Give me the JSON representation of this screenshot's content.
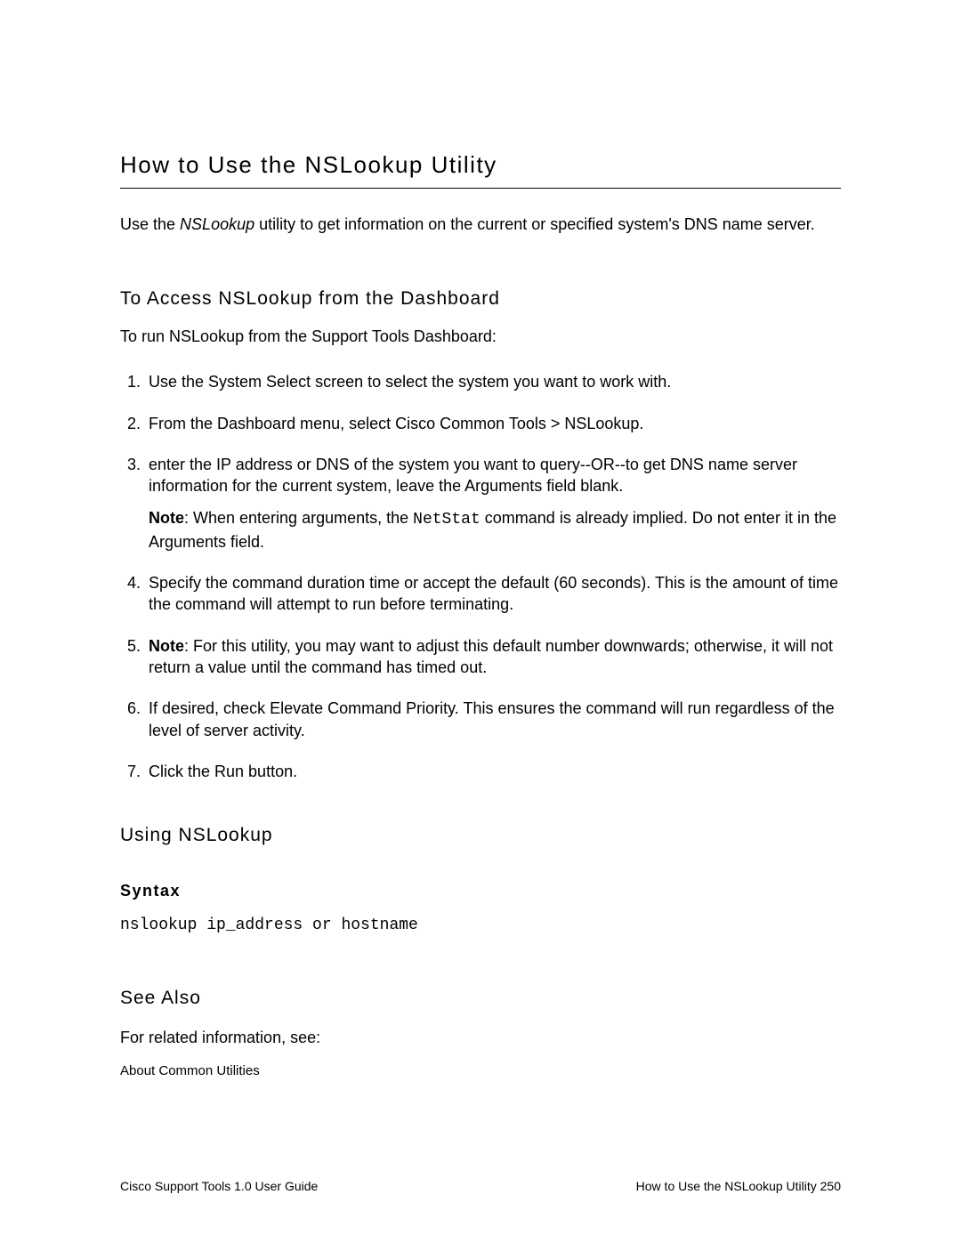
{
  "title": "How to Use the NSLookup Utility",
  "intro_prefix": "Use the ",
  "intro_italic": "NSLookup",
  "intro_suffix": " utility to get information on the current or specified system's DNS name server.",
  "section_access": {
    "heading": "To Access NSLookup from the Dashboard",
    "lead": "To run NSLookup from the Support Tools Dashboard:",
    "steps": {
      "s1": "Use the System Select screen to select the system you want to work with.",
      "s2": "From the Dashboard menu, select Cisco Common Tools > NSLookup.",
      "s3_main": "enter the IP address or DNS of the system you want to query--OR--to get DNS name server information for the current system, leave the Arguments field blank.",
      "s3_note_label": "Note",
      "s3_note_before_mono": ": When entering arguments, the ",
      "s3_note_mono": "NetStat",
      "s3_note_after_mono": " command is already implied. Do not enter it in the Arguments field.",
      "s4": "Specify the command duration time or accept the default (60 seconds). This is the amount of time the command will attempt to run before terminating.",
      "s5_label": "Note",
      "s5_text": ": For this utility, you may want to adjust this default number downwards; otherwise, it will not return a value until the command has timed out.",
      "s6": "If desired, check Elevate Command Priority. This ensures the command will run regardless of the level of server activity.",
      "s7": "Click the Run button."
    }
  },
  "section_using": {
    "heading": "Using NSLookup",
    "syntax_label": "Syntax",
    "syntax_line": "nslookup ip_address or hostname"
  },
  "section_seealso": {
    "heading": "See Also",
    "lead": "For related information, see:",
    "link": "About Common Utilities"
  },
  "footer": {
    "left": "Cisco Support Tools 1.0 User Guide",
    "right": "How to Use the NSLookup Utility   250"
  }
}
